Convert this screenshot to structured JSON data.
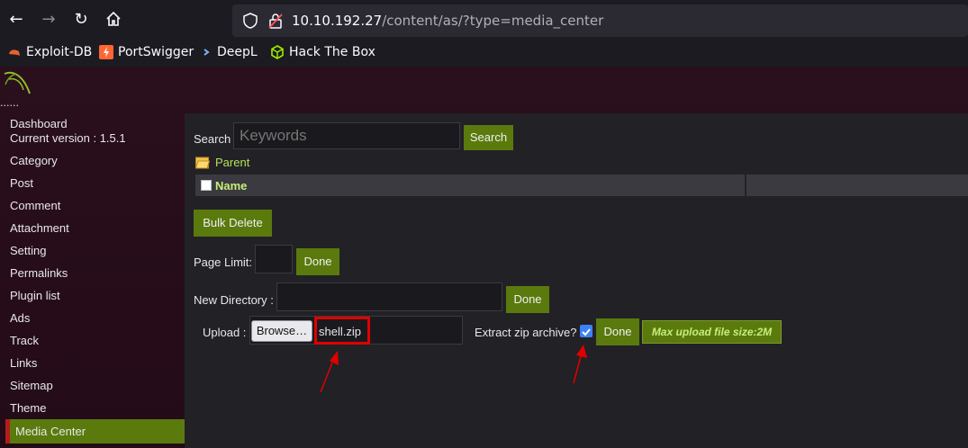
{
  "browser": {
    "url_host": "10.10.192.27",
    "url_path": "/content/as/?type=media_center",
    "bookmarks": [
      "Exploit-DB",
      "PortSwigger",
      "DeepL",
      "Hack The Box"
    ]
  },
  "logo_text": "......",
  "sidebar": {
    "dashboard": "Dashboard",
    "version": "Current version : 1.5.1",
    "items": [
      "Category",
      "Post",
      "Comment",
      "Attachment",
      "Setting",
      "Permalinks",
      "Plugin list",
      "Ads",
      "Track",
      "Links",
      "Sitemap",
      "Theme"
    ],
    "active": "Media Center"
  },
  "main": {
    "search_label": "Search",
    "search_placeholder": "Keywords",
    "search_button": "Search",
    "parent_link": "Parent",
    "table_header_name": "Name",
    "bulk_delete": "Bulk Delete",
    "page_limit_label": "Page Limit:",
    "page_limit_button": "Done",
    "new_dir_label": "New Directory :",
    "new_dir_button": "Done",
    "upload_label": "Upload :",
    "browse_button": "Browse…",
    "upload_file": "shell.zip",
    "extract_label": "Extract zip archive?",
    "upload_button": "Done",
    "max_upload": "Max upload file size:2M"
  },
  "colors": {
    "accent_green": "#5a7a0e",
    "annotation_red": "#e00000"
  }
}
